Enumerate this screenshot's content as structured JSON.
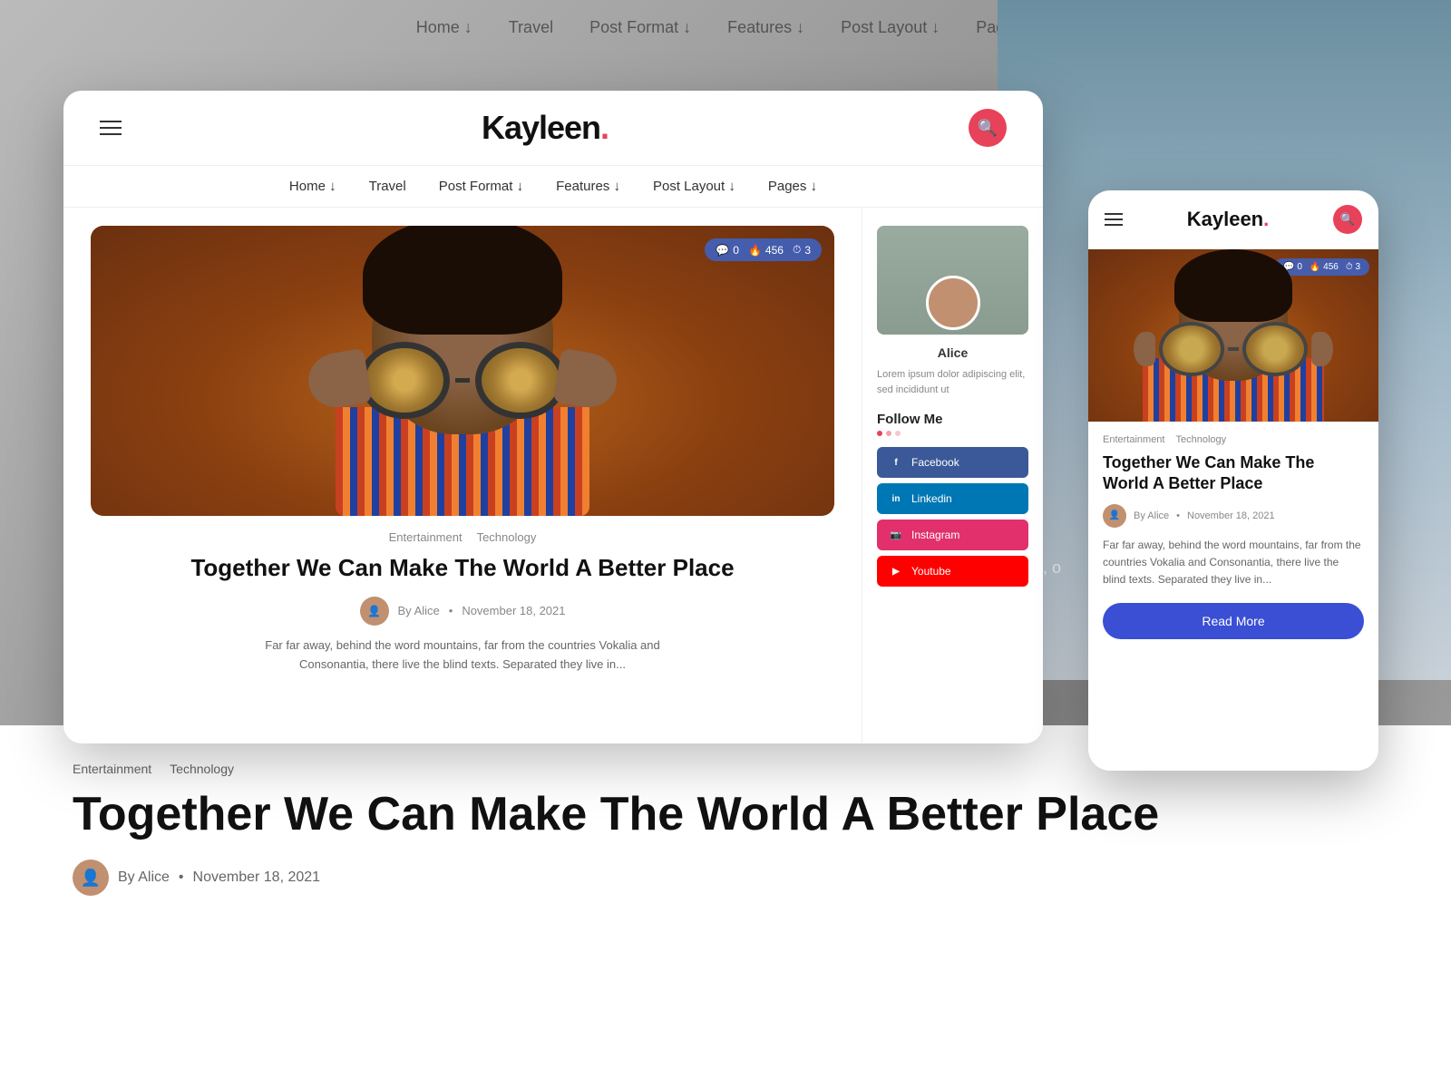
{
  "background": {
    "nav_items": [
      "Home ↓",
      "Travel",
      "Post Format ↓",
      "Features ↓",
      "Post Layout ↓",
      "Pages ↓"
    ]
  },
  "desktop": {
    "header": {
      "logo": "Kayleen",
      "logo_dot": ".",
      "hamburger_label": "Menu",
      "search_label": "Search"
    },
    "nav": {
      "items": [
        {
          "label": "Home ↓"
        },
        {
          "label": "Travel"
        },
        {
          "label": "Post Format ↓"
        },
        {
          "label": "Features ↓"
        },
        {
          "label": "Post Layout ↓"
        },
        {
          "label": "Pages ↓"
        }
      ]
    },
    "article": {
      "stats": {
        "comments": "0",
        "views": "456",
        "rating": "3"
      },
      "categories": [
        "Entertainment",
        "Technology"
      ],
      "title": "Together We Can Make The World A Better Place",
      "author": "By Alice",
      "date": "November 18, 2021",
      "excerpt": "Far far away, behind the word mountains, far from the countries Vokalia and Consonantia, there live the blind texts. Separated they live in..."
    },
    "sidebar": {
      "author_name": "Alice",
      "excerpt": "Lorem ipsum dolor adipiscing elit, sed incididunt ut",
      "follow_title": "Follow Me",
      "social": [
        {
          "label": "Facebook",
          "color": "#3b5998"
        },
        {
          "label": "Linkedin",
          "color": "#0077b5"
        },
        {
          "label": "Instagram",
          "color": "#e1306c"
        },
        {
          "label": "Youtube",
          "color": "#ff0000"
        }
      ]
    }
  },
  "mobile": {
    "header": {
      "logo": "Kayleen",
      "logo_dot": ".",
      "search_label": "Search"
    },
    "article": {
      "stats": {
        "comments": "0",
        "views": "456",
        "rating": "3"
      },
      "categories": [
        "Entertainment",
        "Technology"
      ],
      "title": "Together We Can Make The World A Better Place",
      "author": "By Alice",
      "date": "November 18, 2021",
      "excerpt": "Far far away, behind the word mountains, far from the countries Vokalia and Consonantia, there live the blind texts. Separated they live in...",
      "read_more": "Read More"
    }
  },
  "bg_article": {
    "cats": [
      "Entertainment",
      "Technology"
    ],
    "title": "Together We Can Make The World A Better Place",
    "author": "By Alice",
    "date": "November 18, 2021"
  }
}
